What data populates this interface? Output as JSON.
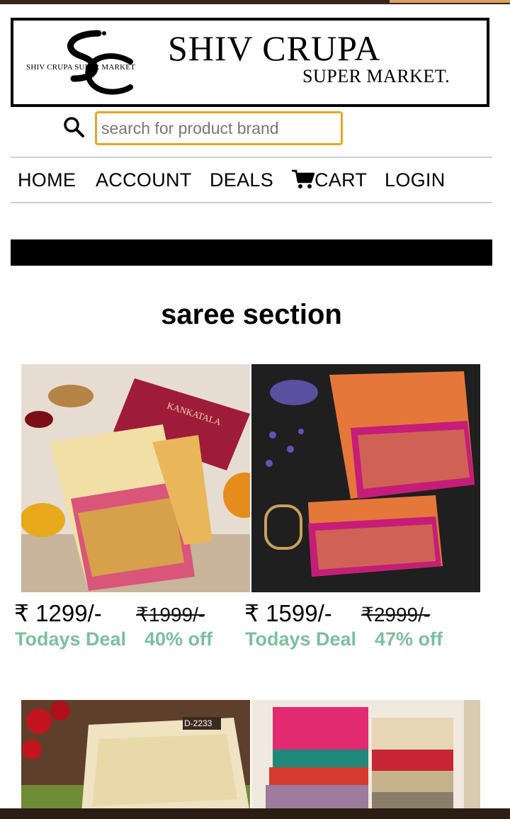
{
  "brand": {
    "title": "SHIV CRUPA",
    "subtitle": "SUPER MARKET.",
    "small_text": "SHIV CRUPA SUPER MARKET"
  },
  "search": {
    "placeholder": "search for product brand",
    "icon": "search-icon"
  },
  "nav": {
    "items": [
      "HOME",
      "ACCOUNT",
      "DEALS",
      "CART",
      "LOGIN"
    ],
    "cart_icon": "cart-icon"
  },
  "section": {
    "title": "saree section"
  },
  "products": [
    {
      "image_label": "KANKATALA",
      "currency": "₹",
      "price": "1299/-",
      "old_price": "1999/-",
      "deal_label": "Todays Deal",
      "discount": "40% off"
    },
    {
      "currency": "₹",
      "price": "1599/-",
      "old_price": "2999/-",
      "deal_label": "Todays Deal",
      "discount": "47% off"
    },
    {
      "image_label": "D-2233"
    },
    {}
  ],
  "colors": {
    "search_border": "#e5a823",
    "deal_green": "#7cbf9e",
    "top_bar": "#3b2418"
  }
}
